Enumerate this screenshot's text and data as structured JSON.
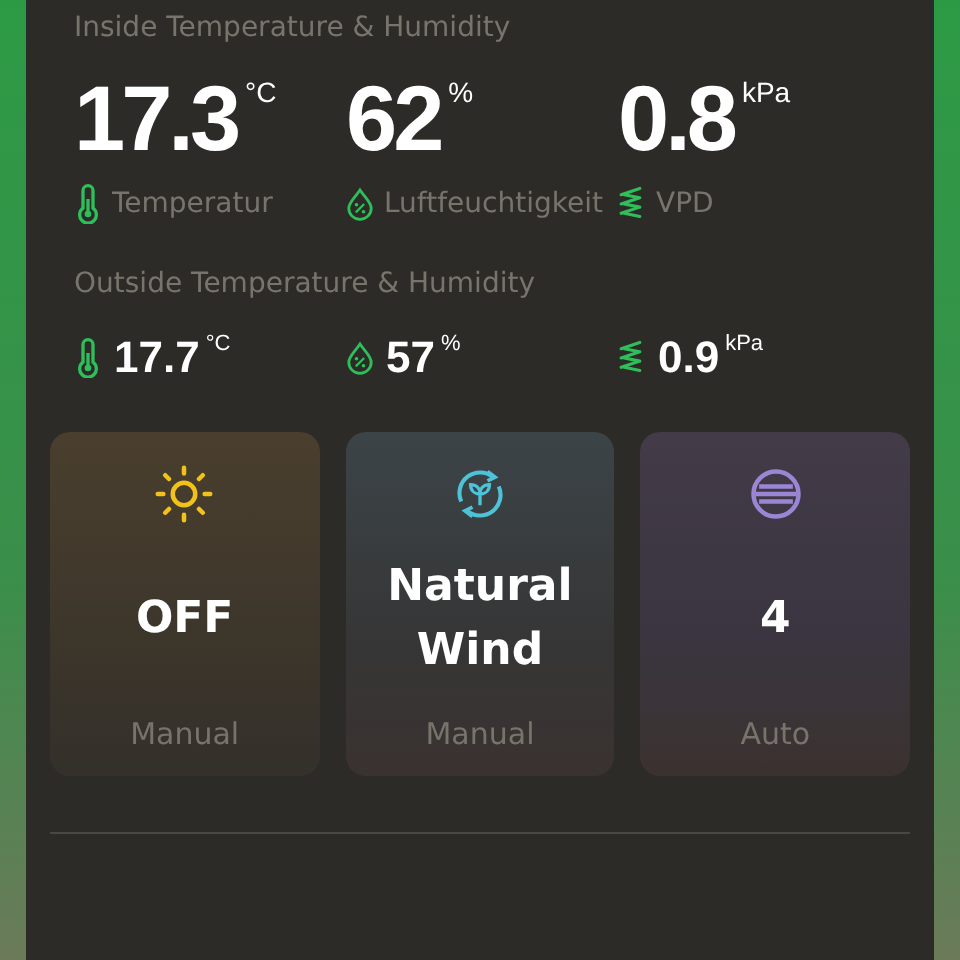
{
  "inside": {
    "title": "Inside Temperature & Humidity",
    "metrics": [
      {
        "kind": "temperature",
        "value": "17.3",
        "unit": "°C",
        "label": "Temperatur"
      },
      {
        "kind": "humidity",
        "value": "62",
        "unit": "%",
        "label": "Luftfeuchtigkeit"
      },
      {
        "kind": "vpd",
        "value": "0.8",
        "unit": "kPa",
        "label": "VPD"
      }
    ]
  },
  "outside": {
    "title": "Outside Temperature & Humidity",
    "metrics": [
      {
        "kind": "temperature",
        "value": "17.7",
        "unit": "°C"
      },
      {
        "kind": "humidity",
        "value": "57",
        "unit": "%"
      },
      {
        "kind": "vpd",
        "value": "0.9",
        "unit": "kPa"
      }
    ]
  },
  "tiles": [
    {
      "kind": "light",
      "value": "OFF",
      "mode": "Manual"
    },
    {
      "kind": "wind",
      "value": "Natural Wind",
      "mode": "Manual"
    },
    {
      "kind": "speed",
      "value": "4",
      "mode": "Auto"
    }
  ]
}
